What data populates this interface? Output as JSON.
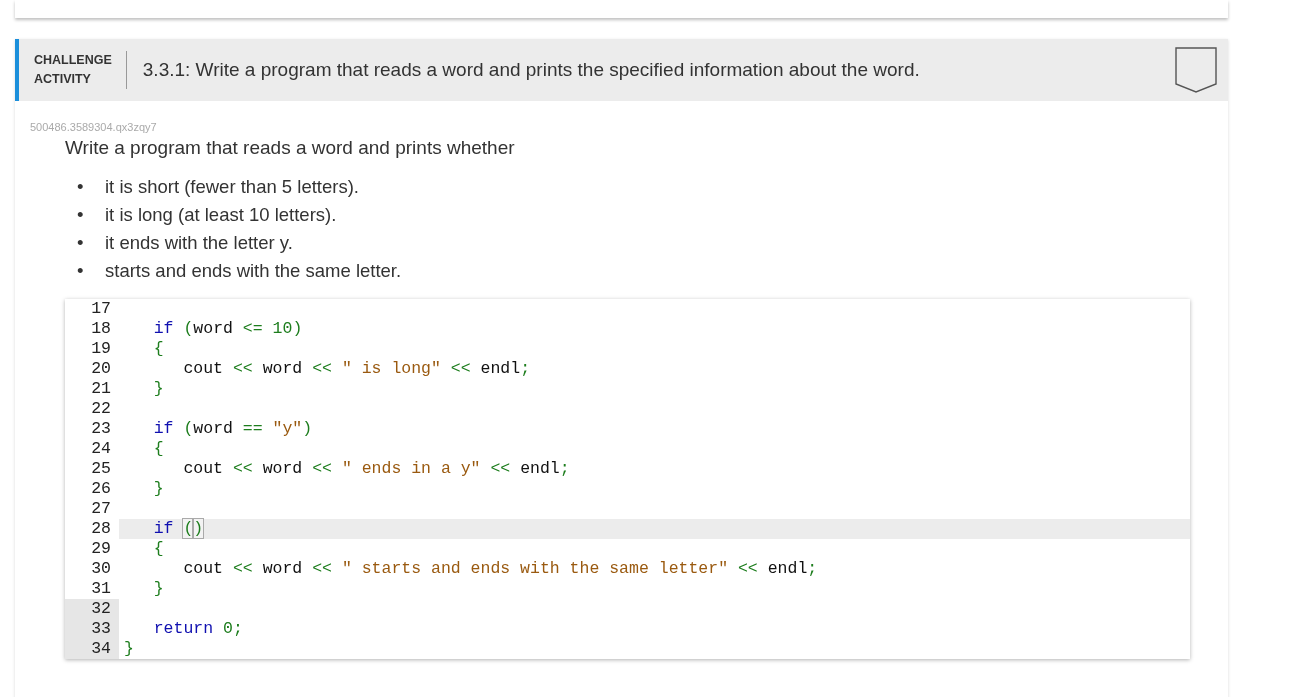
{
  "activity": {
    "label_lines": [
      "CHALLENGE",
      "ACTIVITY"
    ],
    "title": "3.3.1: Write a program that reads a word and prints the specified information about the word.",
    "completed": false
  },
  "problem_id": "500486.3589304.qx3zqy7",
  "prompt": "Write a program that reads a word and prints whether",
  "bullets": [
    {
      "marker": "•",
      "text": "it is short (fewer than 5 letters)."
    },
    {
      "marker": "•",
      "text": "it is long (at least 10 letters)."
    },
    {
      "marker": "•",
      "text": "it ends with the letter y."
    },
    {
      "marker": "•",
      "text": "starts and ends with the same letter."
    }
  ],
  "code": {
    "lines": [
      {
        "number": "17",
        "highlighted": false,
        "gutter_shaded": false
      },
      {
        "number": "18",
        "highlighted": false,
        "gutter_shaded": false,
        "tokens": [
          {
            "kind": "keyword",
            "text": "   if "
          },
          {
            "kind": "punct",
            "text": "("
          },
          {
            "kind": "plain",
            "text": "word "
          },
          {
            "kind": "punct",
            "text": "<= "
          },
          {
            "kind": "number",
            "text": "10"
          },
          {
            "kind": "punct",
            "text": ")"
          }
        ]
      },
      {
        "number": "19",
        "highlighted": false,
        "gutter_shaded": false,
        "tokens": [
          {
            "kind": "punct",
            "text": "   {"
          }
        ]
      },
      {
        "number": "20",
        "highlighted": false,
        "gutter_shaded": false,
        "tokens": [
          {
            "kind": "plain",
            "text": "      cout "
          },
          {
            "kind": "punct",
            "text": "<< "
          },
          {
            "kind": "plain",
            "text": "word "
          },
          {
            "kind": "punct",
            "text": "<< "
          },
          {
            "kind": "string",
            "text": "\" is long\" "
          },
          {
            "kind": "punct",
            "text": "<< "
          },
          {
            "kind": "plain",
            "text": "endl"
          },
          {
            "kind": "punct",
            "text": ";"
          }
        ]
      },
      {
        "number": "21",
        "highlighted": false,
        "gutter_shaded": false,
        "tokens": [
          {
            "kind": "punct",
            "text": "   }"
          }
        ]
      },
      {
        "number": "22",
        "highlighted": false,
        "gutter_shaded": false
      },
      {
        "number": "23",
        "highlighted": false,
        "gutter_shaded": false,
        "tokens": [
          {
            "kind": "keyword",
            "text": "   if "
          },
          {
            "kind": "punct",
            "text": "("
          },
          {
            "kind": "plain",
            "text": "word "
          },
          {
            "kind": "punct",
            "text": "== "
          },
          {
            "kind": "string",
            "text": "\"y\""
          },
          {
            "kind": "punct",
            "text": ")"
          }
        ]
      },
      {
        "number": "24",
        "highlighted": false,
        "gutter_shaded": false,
        "tokens": [
          {
            "kind": "punct",
            "text": "   {"
          }
        ]
      },
      {
        "number": "25",
        "highlighted": false,
        "gutter_shaded": false,
        "tokens": [
          {
            "kind": "plain",
            "text": "      cout "
          },
          {
            "kind": "punct",
            "text": "<< "
          },
          {
            "kind": "plain",
            "text": "word "
          },
          {
            "kind": "punct",
            "text": "<< "
          },
          {
            "kind": "string",
            "text": "\" ends in a y\" "
          },
          {
            "kind": "punct",
            "text": "<< "
          },
          {
            "kind": "plain",
            "text": "endl"
          },
          {
            "kind": "punct",
            "text": ";"
          }
        ]
      },
      {
        "number": "26",
        "highlighted": false,
        "gutter_shaded": false,
        "tokens": [
          {
            "kind": "punct",
            "text": "   }"
          }
        ]
      },
      {
        "number": "27",
        "highlighted": false,
        "gutter_shaded": false
      },
      {
        "number": "28",
        "highlighted": true,
        "gutter_shaded": false,
        "tokens": [
          {
            "kind": "keyword",
            "text": "   if "
          },
          {
            "kind": "matched",
            "text": "("
          },
          {
            "kind": "matched",
            "text": ")"
          }
        ]
      },
      {
        "number": "29",
        "highlighted": false,
        "gutter_shaded": false,
        "tokens": [
          {
            "kind": "punct",
            "text": "   {"
          }
        ]
      },
      {
        "number": "30",
        "highlighted": false,
        "gutter_shaded": false,
        "tokens": [
          {
            "kind": "plain",
            "text": "      cout "
          },
          {
            "kind": "punct",
            "text": "<< "
          },
          {
            "kind": "plain",
            "text": "word "
          },
          {
            "kind": "punct",
            "text": "<< "
          },
          {
            "kind": "string",
            "text": "\" starts and ends with the same letter\" "
          },
          {
            "kind": "punct",
            "text": "<< "
          },
          {
            "kind": "plain",
            "text": "endl"
          },
          {
            "kind": "punct",
            "text": ";"
          }
        ]
      },
      {
        "number": "31",
        "highlighted": false,
        "gutter_shaded": false,
        "tokens": [
          {
            "kind": "punct",
            "text": "   }"
          }
        ]
      },
      {
        "number": "32",
        "highlighted": false,
        "gutter_shaded": true
      },
      {
        "number": "33",
        "highlighted": false,
        "gutter_shaded": true,
        "tokens": [
          {
            "kind": "keyword",
            "text": "   return "
          },
          {
            "kind": "number",
            "text": "0"
          },
          {
            "kind": "punct",
            "text": ";"
          }
        ]
      },
      {
        "number": "34",
        "highlighted": false,
        "gutter_shaded": true,
        "tokens": [
          {
            "kind": "punct",
            "text": "}"
          }
        ]
      }
    ]
  }
}
